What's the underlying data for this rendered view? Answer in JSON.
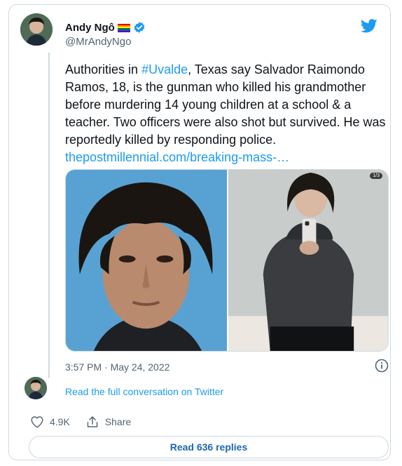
{
  "author": {
    "name": "Andy Ngô",
    "flag_emoji": "🏳️‍🌈",
    "handle": "@MrAndyNgo",
    "verified": true
  },
  "tweet": {
    "text_before": "Authorities in ",
    "hashtag": "#Uvalde",
    "text_after": ", Texas say Salvador Raimondo Ramos, 18, is the gunman who killed his grandmother before murdering 14 young children at a school & a teacher. Two officers were also shot but survived. He was reportedly killed by responding police. ",
    "link": "thepostmillennial.com/breaking-mass-…",
    "timestamp": "3:57 PM · May 24, 2022"
  },
  "media": {
    "image_counter": "1/3",
    "images": [
      "photo-mugshot",
      "photo-mirror-selfie"
    ]
  },
  "conversation": {
    "read_full_label": "Read the full conversation on Twitter"
  },
  "actions": {
    "likes": "4.9K",
    "share_label": "Share",
    "read_replies_label": "Read 636 replies"
  },
  "colors": {
    "accent": "#1d9bf0",
    "text": "#0f1419",
    "muted": "#536471",
    "border": "#cfd9de"
  },
  "icons": [
    "twitter-bird-icon",
    "verified-badge-icon",
    "info-icon",
    "heart-icon",
    "share-icon"
  ]
}
